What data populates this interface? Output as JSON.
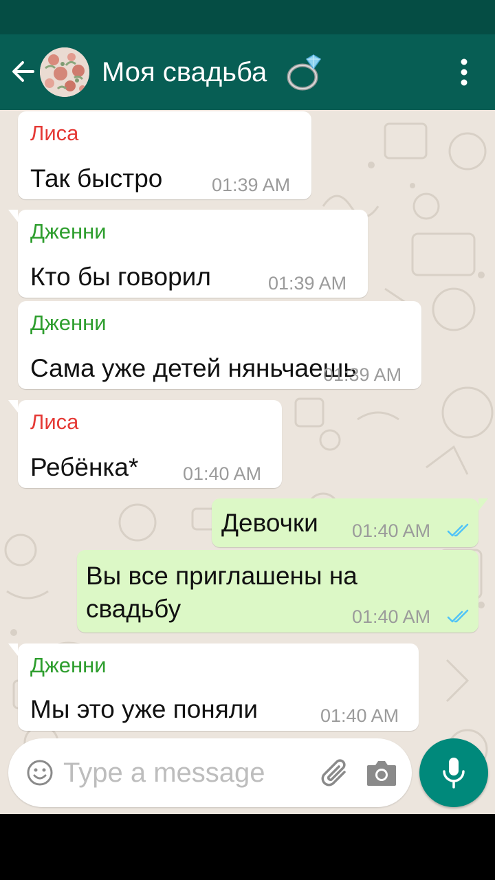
{
  "header": {
    "title": "Моя свадьба",
    "title_emoji_icon": "ring-icon",
    "back_icon": "arrow-left-icon",
    "menu_icon": "more-vert-icon",
    "avatar_icon": "group-avatar"
  },
  "colors": {
    "header": "#075e54",
    "status_bar": "#054d44",
    "chat_bg": "#ece5dd",
    "incoming_bubble": "#ffffff",
    "outgoing_bubble": "#dcf8c6",
    "sender_lisa": "#e53935",
    "sender_jenni": "#2e9e2e",
    "time": "#9b9b9b",
    "read_ticks": "#4fc3f7",
    "fab": "#00897b"
  },
  "messages": [
    {
      "direction": "in",
      "sender": "Лиса",
      "text": "Так быстро",
      "time": "01:39 AM"
    },
    {
      "direction": "in",
      "sender": "Дженни",
      "text": "Кто бы говорил",
      "time": "01:39 AM"
    },
    {
      "direction": "in",
      "sender": "Дженни",
      "text": "Сама уже детей няньчаешь",
      "time": "01:39 AM"
    },
    {
      "direction": "in",
      "sender": "Лиса",
      "text": "Ребёнка*",
      "time": "01:40 AM"
    },
    {
      "direction": "out",
      "text": "Девочки",
      "time": "01:40 AM",
      "status": "read"
    },
    {
      "direction": "out",
      "text_line1": "Вы все приглашены на",
      "text_line2": "свадьбу",
      "time": "01:40 AM",
      "status": "read"
    },
    {
      "direction": "in",
      "sender": "Дженни",
      "text": "Мы это уже поняли",
      "time": "01:40 AM"
    }
  ],
  "composer": {
    "placeholder": "Type a message",
    "value": "",
    "emoji_icon": "emoji-icon",
    "attach_icon": "paperclip-icon",
    "camera_icon": "camera-icon",
    "mic_icon": "mic-icon"
  }
}
